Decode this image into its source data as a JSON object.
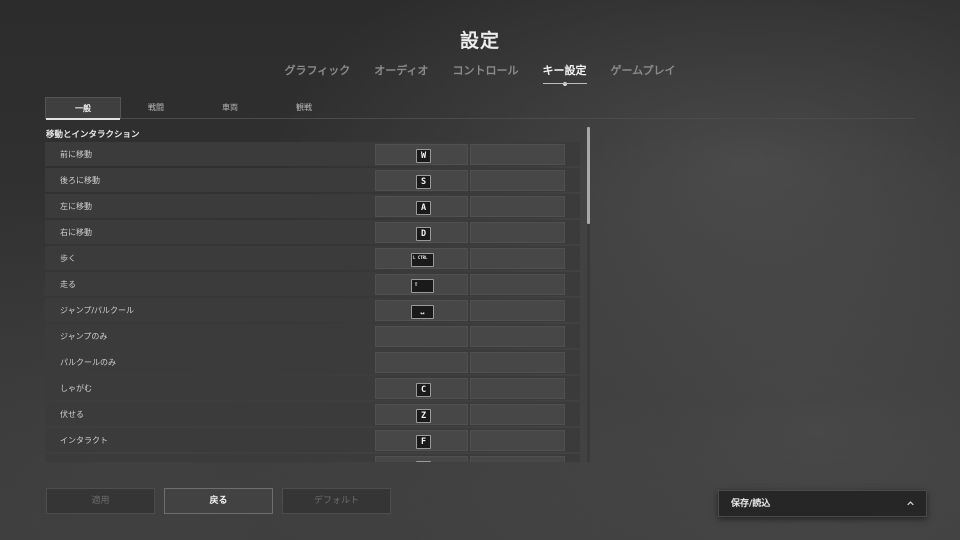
{
  "header": {
    "title": "設定"
  },
  "main_tabs": [
    "グラフィック",
    "オーディオ",
    "コントロール",
    "キー設定",
    "ゲームプレイ"
  ],
  "main_tab_active": "キー設定",
  "sub_tabs": [
    "一般",
    "戦闘",
    "車両",
    "観戦"
  ],
  "sub_tab_active": "一般",
  "section": {
    "title": "移動とインタラクション"
  },
  "bindings": [
    {
      "action": "前に移動",
      "key": "W"
    },
    {
      "action": "後ろに移動",
      "key": "S"
    },
    {
      "action": "左に移動",
      "key": "A"
    },
    {
      "action": "右に移動",
      "key": "D"
    },
    {
      "action": "歩く",
      "key": "L CTRL"
    },
    {
      "action": "走る",
      "key": "⇧"
    },
    {
      "action": "ジャンプ/パルクール",
      "key": "⎵"
    },
    {
      "action": "ジャンプのみ",
      "key": ""
    },
    {
      "action": "パルクールのみ",
      "key": ""
    },
    {
      "action": "しゃがむ",
      "key": "C"
    },
    {
      "action": "伏せる",
      "key": "Z"
    },
    {
      "action": "インタラクト",
      "key": "F"
    }
  ],
  "footer": {
    "apply_label": "適用",
    "back_label": "戻る",
    "default_label": "デフォルト",
    "save_load_label": "保存/読込"
  },
  "icons": {
    "save_load_toggle": "chevron-up-icon"
  }
}
